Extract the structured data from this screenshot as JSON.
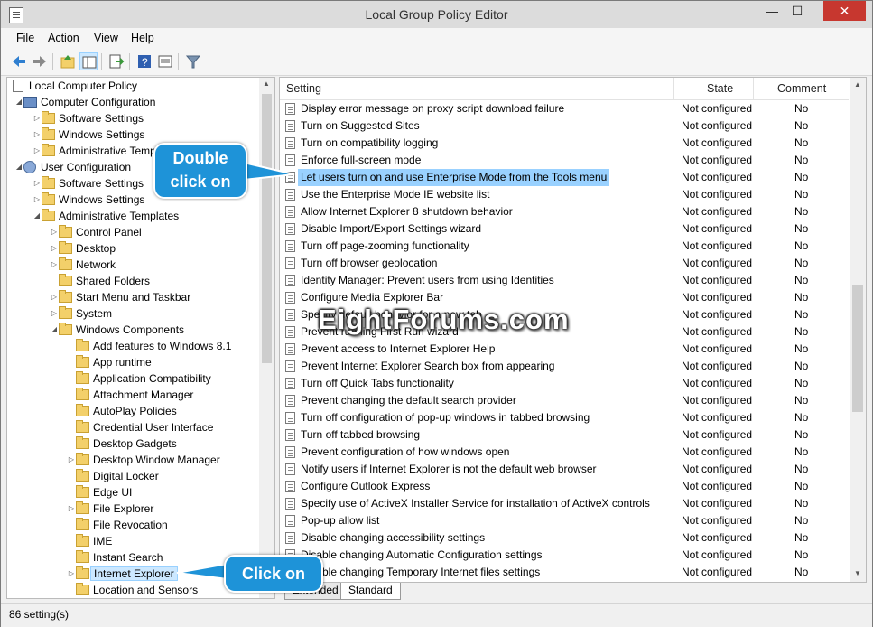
{
  "window": {
    "title": "Local Group Policy Editor",
    "minimize": "—",
    "maximize": "☐",
    "close": "✕"
  },
  "menu": [
    "File",
    "Action",
    "View",
    "Help"
  ],
  "toolbar": [
    "back-icon",
    "forward-icon",
    "up-folder-icon",
    "show-hide-tree-icon",
    "export-list-icon",
    "help-icon",
    "properties-icon",
    "filter-icon"
  ],
  "tree": {
    "root": "Local Computer Policy",
    "computer_config": "Computer Configuration",
    "cc_software": "Software Settings",
    "cc_windows": "Windows Settings",
    "cc_admin": "Administrative Templates",
    "user_config": "User Configuration",
    "uc_software": "Software Settings",
    "uc_windows": "Windows Settings",
    "uc_admin": "Administrative Templates",
    "control_panel": "Control Panel",
    "desktop": "Desktop",
    "network": "Network",
    "shared_folders": "Shared Folders",
    "start_menu": "Start Menu and Taskbar",
    "system": "System",
    "windows_components": "Windows Components",
    "components": [
      "Add features to Windows 8.1",
      "App runtime",
      "Application Compatibility",
      "Attachment Manager",
      "AutoPlay Policies",
      "Credential User Interface",
      "Desktop Gadgets",
      "Desktop Window Manager",
      "Digital Locker",
      "Edge UI",
      "File Explorer",
      "File Revocation",
      "IME",
      "Instant Search",
      "Internet Explorer",
      "Location and Sensors"
    ]
  },
  "list": {
    "headers": {
      "setting": "Setting",
      "state": "State",
      "comment": "Comment"
    },
    "rows": [
      {
        "name": "Display error message on proxy script download failure",
        "state": "Not configured",
        "comment": "No"
      },
      {
        "name": "Turn on Suggested Sites",
        "state": "Not configured",
        "comment": "No"
      },
      {
        "name": "Turn on compatibility logging",
        "state": "Not configured",
        "comment": "No"
      },
      {
        "name": "Enforce full-screen mode",
        "state": "Not configured",
        "comment": "No"
      },
      {
        "name": "Let users turn on and use Enterprise Mode from the Tools menu",
        "state": "Not configured",
        "comment": "No"
      },
      {
        "name": "Use the Enterprise Mode IE website list",
        "state": "Not configured",
        "comment": "No"
      },
      {
        "name": "Allow Internet Explorer 8 shutdown behavior",
        "state": "Not configured",
        "comment": "No"
      },
      {
        "name": "Disable Import/Export Settings wizard",
        "state": "Not configured",
        "comment": "No"
      },
      {
        "name": "Turn off page-zooming functionality",
        "state": "Not configured",
        "comment": "No"
      },
      {
        "name": "Turn off browser geolocation",
        "state": "Not configured",
        "comment": "No"
      },
      {
        "name": "Identity Manager: Prevent users from using Identities",
        "state": "Not configured",
        "comment": "No"
      },
      {
        "name": "Configure Media Explorer Bar",
        "state": "Not configured",
        "comment": "No"
      },
      {
        "name": "Specify default behavior for a new tab",
        "state": "Not configured",
        "comment": "No"
      },
      {
        "name": "Prevent running First Run wizard",
        "state": "Not configured",
        "comment": "No"
      },
      {
        "name": "Prevent access to Internet Explorer Help",
        "state": "Not configured",
        "comment": "No"
      },
      {
        "name": "Prevent Internet Explorer Search box from appearing",
        "state": "Not configured",
        "comment": "No"
      },
      {
        "name": "Turn off Quick Tabs functionality",
        "state": "Not configured",
        "comment": "No"
      },
      {
        "name": "Prevent changing the default search provider",
        "state": "Not configured",
        "comment": "No"
      },
      {
        "name": "Turn off configuration of pop-up windows in tabbed browsing",
        "state": "Not configured",
        "comment": "No"
      },
      {
        "name": "Turn off tabbed browsing",
        "state": "Not configured",
        "comment": "No"
      },
      {
        "name": "Prevent configuration of how windows open",
        "state": "Not configured",
        "comment": "No"
      },
      {
        "name": "Notify users if Internet Explorer is not the default web browser",
        "state": "Not configured",
        "comment": "No"
      },
      {
        "name": "Configure Outlook Express",
        "state": "Not configured",
        "comment": "No"
      },
      {
        "name": "Specify use of ActiveX Installer Service for installation of ActiveX controls",
        "state": "Not configured",
        "comment": "No"
      },
      {
        "name": "Pop-up allow list",
        "state": "Not configured",
        "comment": "No"
      },
      {
        "name": "Disable changing accessibility settings",
        "state": "Not configured",
        "comment": "No"
      },
      {
        "name": "Disable changing Automatic Configuration settings",
        "state": "Not configured",
        "comment": "No"
      },
      {
        "name": "Disable changing Temporary Internet files settings",
        "state": "Not configured",
        "comment": "No"
      }
    ]
  },
  "tabs": {
    "extended": "Extended",
    "standard": "Standard"
  },
  "status": "86 setting(s)",
  "callouts": {
    "double_click": "Double click on",
    "click": "Click on"
  },
  "watermark": "EightForums.com",
  "colors": {
    "callout": "#1e93d8",
    "selection": "#99d1ff",
    "close": "#c7372f"
  }
}
